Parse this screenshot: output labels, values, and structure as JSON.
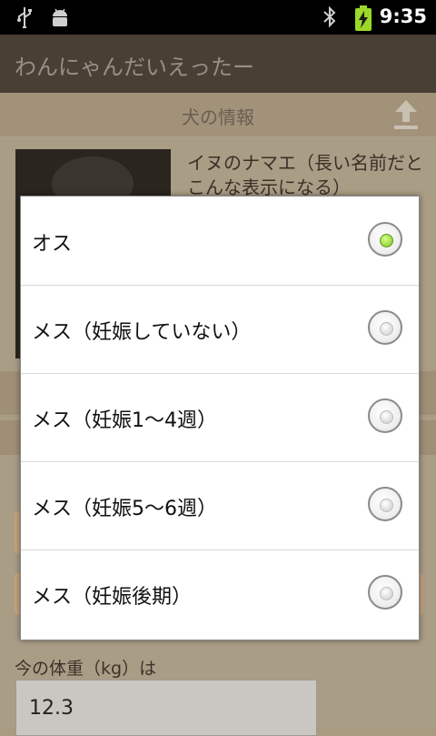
{
  "status_bar": {
    "time": "9:35",
    "icons": [
      "usb-icon",
      "android-debug-icon",
      "bluetooth-icon",
      "battery-charging-icon"
    ]
  },
  "app": {
    "title": "わんにゃんだいえったー"
  },
  "page": {
    "section_title": "犬の情報",
    "dog_name": "イヌのナマエ（長い名前だとこんな表示になる）",
    "weight_label": "今の体重（kg）は",
    "weight_value": "12.3"
  },
  "dialog": {
    "options": [
      {
        "label": "オス",
        "selected": true
      },
      {
        "label": "メス（妊娠していない）",
        "selected": false
      },
      {
        "label": "メス（妊娠1〜4週）",
        "selected": false
      },
      {
        "label": "メス（妊娠5〜6週）",
        "selected": false
      },
      {
        "label": "メス（妊娠後期）",
        "selected": false
      }
    ]
  },
  "colors": {
    "selected_radio": "#79c41e",
    "title_bar": "#4a3f35",
    "dim_background": "#aa9d86"
  }
}
